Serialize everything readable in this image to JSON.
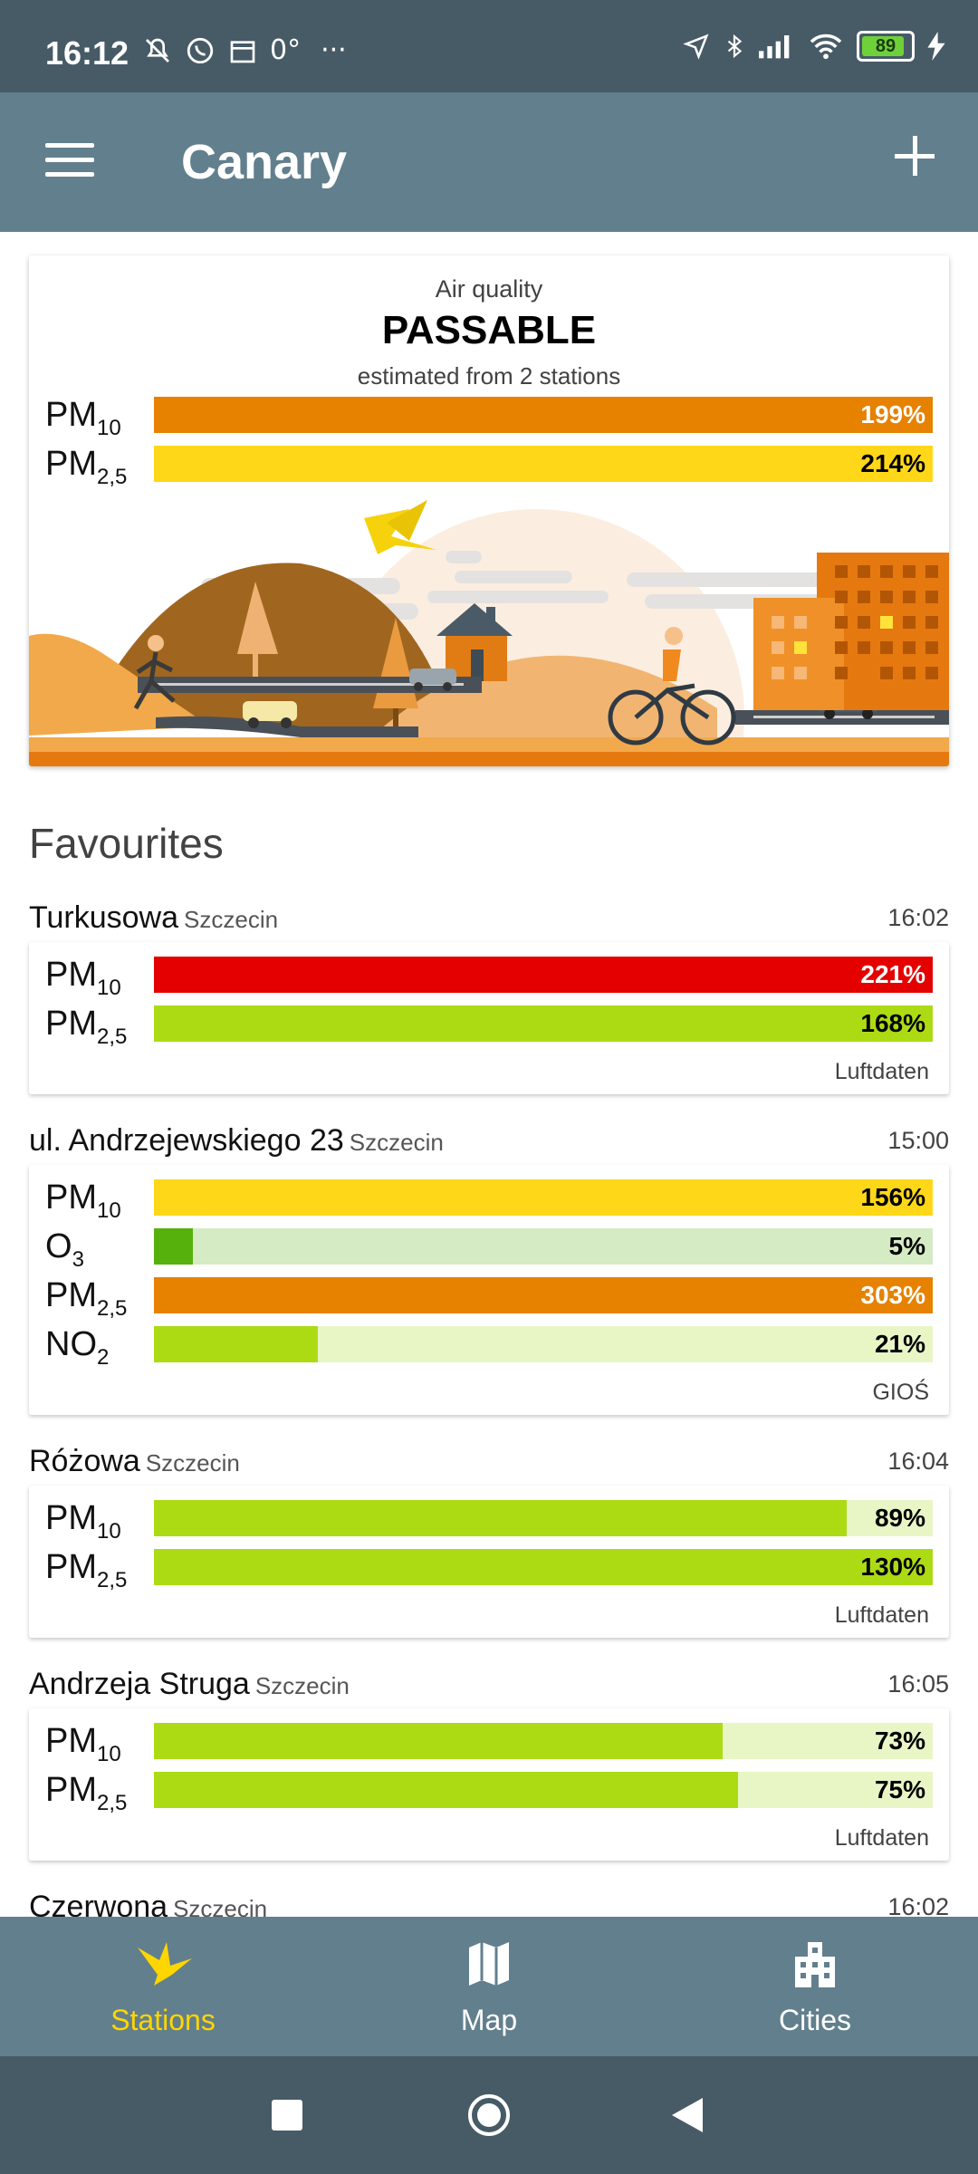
{
  "status_bar": {
    "time": "16:12",
    "icons_left": [
      "mute-bell-icon",
      "whatsapp-icon",
      "calendar-icon",
      "temperature-icon",
      "more-dots-icon"
    ],
    "temp_text": "0°",
    "dots": "···",
    "icons_right": [
      "location-icon",
      "bluetooth-icon",
      "signal-icon",
      "wifi-icon",
      "battery-icon",
      "charging-icon"
    ],
    "battery": "89"
  },
  "app_bar": {
    "title": "Canary"
  },
  "air_quality": {
    "caption": "Air quality",
    "status": "PASSABLE",
    "subtitle": "estimated from 2 stations",
    "rows": [
      {
        "name": "PM",
        "sub": "10",
        "value_text": "199%",
        "fill": 1.0,
        "color": "#e68200",
        "bg": "#e68200",
        "text_color": "#ffffff"
      },
      {
        "name": "PM",
        "sub": "2,5",
        "value_text": "214%",
        "fill": 1.0,
        "color": "#ffd719",
        "bg": "#ffd719",
        "text_color": "#000000"
      }
    ]
  },
  "favourites": {
    "title": "Favourites",
    "stations": [
      {
        "name": "Turkusowa",
        "city": "Szczecin",
        "time": "16:02",
        "source": "Luftdaten",
        "rows": [
          {
            "name": "PM",
            "sub": "10",
            "value_text": "221%",
            "fill": 1.0,
            "color": "#e50000",
            "bg": "#e50000",
            "text_color": "#ffffff"
          },
          {
            "name": "PM",
            "sub": "2,5",
            "value_text": "168%",
            "fill": 1.0,
            "color": "#acdb14",
            "bg": "#acdb14",
            "text_color": "#000000"
          }
        ]
      },
      {
        "name": "ul. Andrzejewskiego 23",
        "city": "Szczecin",
        "time": "15:00",
        "source": "GIOŚ",
        "rows": [
          {
            "name": "PM",
            "sub": "10",
            "value_text": "156%",
            "fill": 1.0,
            "color": "#ffd719",
            "bg": "#ffd719",
            "text_color": "#000000"
          },
          {
            "name": "O",
            "sub": "3",
            "value_text": "5%",
            "fill": 0.05,
            "color": "#56b10d",
            "bg": "#d5ebc4",
            "text_color": "#000000"
          },
          {
            "name": "PM",
            "sub": "2,5",
            "value_text": "303%",
            "fill": 1.0,
            "color": "#e68200",
            "bg": "#e68200",
            "text_color": "#ffffff"
          },
          {
            "name": "NO",
            "sub": "2",
            "value_text": "21%",
            "fill": 0.21,
            "color": "#acdb14",
            "bg": "#e8f6c6",
            "text_color": "#000000"
          }
        ]
      },
      {
        "name": "Różowa",
        "city": "Szczecin",
        "time": "16:04",
        "source": "Luftdaten",
        "rows": [
          {
            "name": "PM",
            "sub": "10",
            "value_text": "89%",
            "fill": 0.89,
            "color": "#acdb14",
            "bg": "#e8f6c6",
            "text_color": "#000000"
          },
          {
            "name": "PM",
            "sub": "2,5",
            "value_text": "130%",
            "fill": 1.0,
            "color": "#acdb14",
            "bg": "#acdb14",
            "text_color": "#000000"
          }
        ]
      },
      {
        "name": "Andrzeja Struga",
        "city": "Szczecin",
        "time": "16:05",
        "source": "Luftdaten",
        "rows": [
          {
            "name": "PM",
            "sub": "10",
            "value_text": "73%",
            "fill": 0.73,
            "color": "#acdb14",
            "bg": "#e8f6c6",
            "text_color": "#000000"
          },
          {
            "name": "PM",
            "sub": "2,5",
            "value_text": "75%",
            "fill": 0.75,
            "color": "#acdb14",
            "bg": "#e8f6c6",
            "text_color": "#000000"
          }
        ]
      },
      {
        "name": "Czerwona",
        "city": "Szczecin",
        "time": "16:02",
        "source": "",
        "rows": []
      }
    ]
  },
  "bottom_nav": {
    "items": [
      {
        "label": "Stations",
        "icon": "bird-icon",
        "active": true
      },
      {
        "label": "Map",
        "icon": "map-icon",
        "active": false
      },
      {
        "label": "Cities",
        "icon": "city-icon",
        "active": false
      }
    ]
  },
  "system_nav": {
    "icons": [
      "recents-square-icon",
      "home-circle-icon",
      "back-triangle-icon"
    ]
  }
}
